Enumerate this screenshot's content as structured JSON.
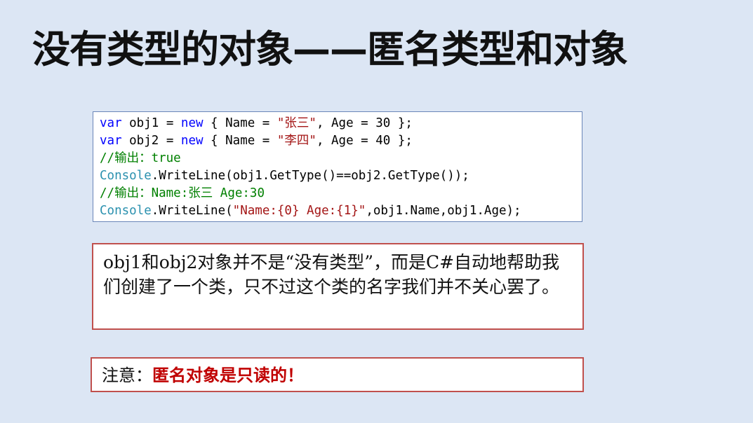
{
  "slide": {
    "title": "没有类型的对象——匿名类型和对象"
  },
  "code": {
    "line1": {
      "kw1": "var",
      "a": " obj1 = ",
      "kw2": "new",
      "b": " { Name = ",
      "str": "\"张三\"",
      "c": ", Age = 30 };"
    },
    "line2": {
      "kw1": "var",
      "a": " obj2 = ",
      "kw2": "new",
      "b": " { Name = ",
      "str": "\"李四\"",
      "c": ", Age = 40 };"
    },
    "line3": {
      "comment": "//输出：true"
    },
    "line4": {
      "type": "Console",
      "rest": ".WriteLine(obj1.GetType()==obj2.GetType());"
    },
    "line5": {
      "comment": "//输出：Name:张三 Age:30"
    },
    "line6": {
      "type": "Console",
      "a": ".WriteLine(",
      "str": "\"Name:{0} Age:{1}\"",
      "b": ",obj1.Name,obj1.Age);"
    }
  },
  "note": {
    "text": "obj1和obj2对象并不是“没有类型”，而是C#自动地帮助我们创建了一个类，只不过这个类的名字我们并不关心罢了。"
  },
  "warning": {
    "label": "注意：",
    "text": "匿名对象是只读的！"
  },
  "colors": {
    "background": "#dce6f4",
    "keyword": "#0000ff",
    "string": "#a31515",
    "comment": "#008000",
    "type": "#2b91af",
    "box_border": "#c0504d",
    "warning_text": "#c00000"
  }
}
